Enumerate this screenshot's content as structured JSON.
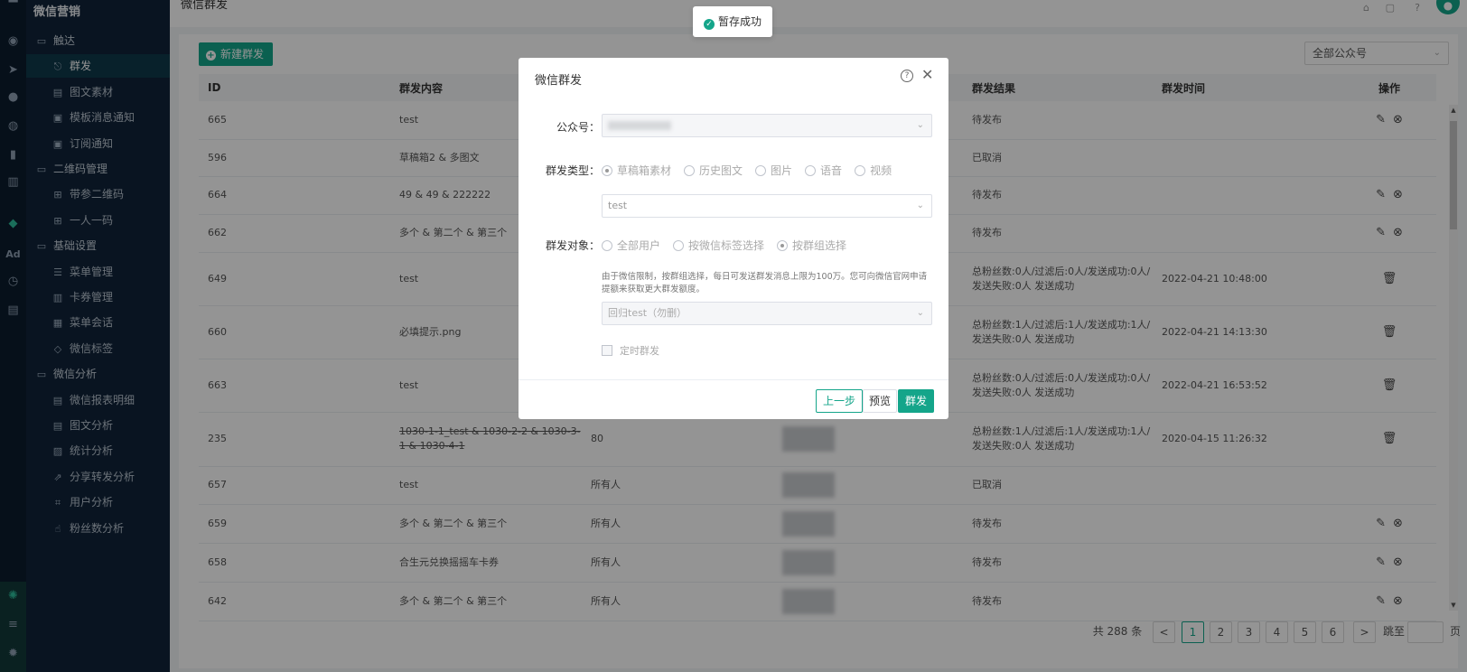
{
  "sidebar": {
    "brand": "微信营销",
    "items": [
      {
        "label": "触达",
        "type": "group",
        "icon": "folder-icon"
      },
      {
        "label": "群发",
        "type": "sub",
        "icon": "send-icon",
        "active": true
      },
      {
        "label": "图文素材",
        "type": "sub",
        "icon": "document-icon"
      },
      {
        "label": "模板消息通知",
        "type": "sub",
        "icon": "message-icon"
      },
      {
        "label": "订阅通知",
        "type": "sub",
        "icon": "message-icon"
      },
      {
        "label": "二维码管理",
        "type": "group",
        "icon": "folder-icon"
      },
      {
        "label": "带参二维码",
        "type": "sub",
        "icon": "qrcode-icon"
      },
      {
        "label": "一人一码",
        "type": "sub",
        "icon": "qrcode-icon"
      },
      {
        "label": "基础设置",
        "type": "group",
        "icon": "folder-icon"
      },
      {
        "label": "菜单管理",
        "type": "sub",
        "icon": "list-icon"
      },
      {
        "label": "卡券管理",
        "type": "sub",
        "icon": "card-icon"
      },
      {
        "label": "菜单会话",
        "type": "sub",
        "icon": "chat-icon"
      },
      {
        "label": "微信标签",
        "type": "sub",
        "icon": "tag-icon"
      },
      {
        "label": "微信分析",
        "type": "group",
        "icon": "folder-icon"
      },
      {
        "label": "微信报表明细",
        "type": "sub",
        "icon": "document-icon"
      },
      {
        "label": "图文分析",
        "type": "sub",
        "icon": "document-icon"
      },
      {
        "label": "统计分析",
        "type": "sub",
        "icon": "chart-icon"
      },
      {
        "label": "分享转发分析",
        "type": "sub",
        "icon": "share-icon"
      },
      {
        "label": "用户分析",
        "type": "sub",
        "icon": "user-scan-icon"
      },
      {
        "label": "粉丝数分析",
        "type": "sub",
        "icon": "thumb-up-icon"
      }
    ]
  },
  "rail": {
    "ad_label": "Ad"
  },
  "topbar": {
    "title": "微信群发"
  },
  "toolbar": {
    "new_button": "新建群发",
    "account_select": "全部公众号"
  },
  "table": {
    "headers": [
      "ID",
      "群发内容",
      "",
      "",
      "群发结果",
      "群发时间",
      "操作"
    ],
    "rows": [
      {
        "id": "665",
        "content": "test",
        "target": "",
        "result": "待发布",
        "time": "",
        "ops": [
          "edit",
          "cancel"
        ],
        "h": 42
      },
      {
        "id": "596",
        "content": "草稿箱2 & 多图文",
        "target": "",
        "result": "已取消",
        "time": "",
        "ops": [],
        "h": 41
      },
      {
        "id": "664",
        "content": "49 & 49 & 222222",
        "target": "",
        "result": "待发布",
        "time": "",
        "ops": [
          "edit",
          "cancel"
        ],
        "h": 42
      },
      {
        "id": "662",
        "content": "多个 & 第二个 & 第三个",
        "target": "",
        "result": "待发布",
        "time": "",
        "ops": [
          "edit",
          "cancel"
        ],
        "h": 42
      },
      {
        "id": "649",
        "content": "test",
        "target": "",
        "result": "总粉丝数:0人/过滤后:0人/发送成功:0人/发送失败:0人 发送成功",
        "time": "2022-04-21 10:48:00",
        "ops": [
          "delete"
        ],
        "h": 59
      },
      {
        "id": "660",
        "content": "必填提示.png",
        "target": "",
        "result": "总粉丝数:1人/过滤后:1人/发送成功:1人/发送失败:0人 发送成功",
        "time": "2022-04-21 14:13:30",
        "ops": [
          "delete"
        ],
        "h": 59
      },
      {
        "id": "663",
        "content": "test",
        "target": "",
        "result": "总粉丝数:0人/过滤后:0人/发送成功:0人/发送失败:0人 发送成功",
        "time": "2022-04-21 16:53:52",
        "ops": [
          "delete"
        ],
        "h": 59
      },
      {
        "id": "235",
        "content": "1030-1-1_test & 1030-2-2 & 1030-3-1 & 1030-4-1",
        "strike": true,
        "target": "80",
        "result": "总粉丝数:1人/过滤后:1人/发送成功:1人/发送失败:0人 发送成功",
        "time": "2020-04-15 11:26:32",
        "ops": [
          "delete"
        ],
        "h": 60
      },
      {
        "id": "657",
        "content": "test",
        "target": "所有人",
        "result": "已取消",
        "time": "",
        "ops": [],
        "h": 42
      },
      {
        "id": "659",
        "content": "多个 & 第二个 & 第三个",
        "target": "所有人",
        "result": "待发布",
        "time": "",
        "ops": [
          "edit",
          "cancel"
        ],
        "h": 43
      },
      {
        "id": "658",
        "content": "合生元兑换摇摇车卡券",
        "target": "所有人",
        "result": "待发布",
        "time": "",
        "ops": [
          "edit",
          "cancel"
        ],
        "h": 43
      },
      {
        "id": "642",
        "content": "多个 & 第二个 & 第三个",
        "target": "所有人",
        "result": "待发布",
        "time": "",
        "ops": [
          "edit",
          "cancel"
        ],
        "h": 43
      }
    ]
  },
  "pager": {
    "total": "共 288 条",
    "prev": "<",
    "pages": [
      "1",
      "2",
      "3",
      "4",
      "5",
      "6"
    ],
    "current": "1",
    "next": ">",
    "jump_label": "跳至",
    "page_suffix": "页"
  },
  "toast": {
    "text": "暂存成功"
  },
  "modal": {
    "title": "微信群发",
    "account_label": "公众号：",
    "type_label": "群发类型：",
    "type_options": [
      {
        "label": "草稿箱素材",
        "checked": true
      },
      {
        "label": "历史图文",
        "checked": false
      },
      {
        "label": "图片",
        "checked": false
      },
      {
        "label": "语音",
        "checked": false
      },
      {
        "label": "视频",
        "checked": false
      }
    ],
    "material_value": "test",
    "target_label": "群发对象：",
    "target_options": [
      {
        "label": "全部用户",
        "checked": false
      },
      {
        "label": "按微信标签选择",
        "checked": false
      },
      {
        "label": "按群组选择",
        "checked": true
      }
    ],
    "note": "由于微信限制，按群组选择，每日可发送群发消息上限为100万。您可向微信官网申请提额来获取更大群发额度。",
    "group_value": "回归test（勿删）",
    "schedule_label": "定时群发",
    "btn_prev": "上一步",
    "btn_preview": "预览",
    "btn_send": "群发"
  },
  "colors": {
    "accent": "#14a58a",
    "sidebar_bg": "#11243a"
  }
}
